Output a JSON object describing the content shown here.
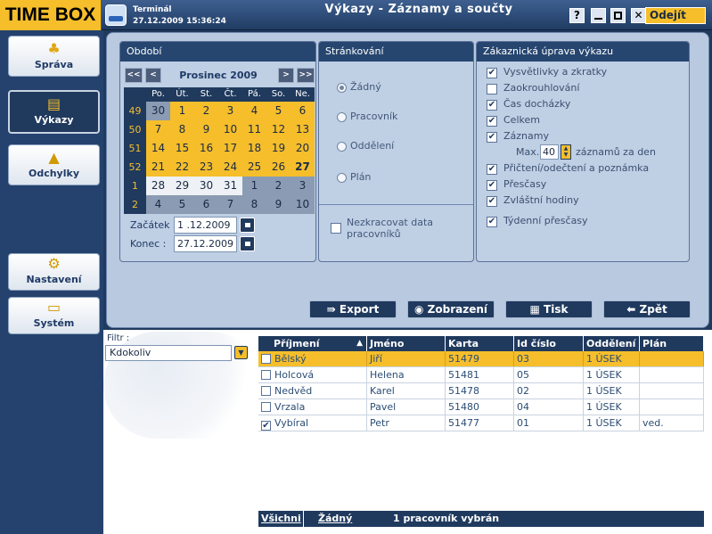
{
  "app": {
    "logo": "TIME BOX",
    "terminal_label": "Terminál",
    "datetime": "27.12.2009 15:36:24",
    "window_title": "Výkazy - Záznamy a součty",
    "help_label": "?",
    "logout_label": "Odejít"
  },
  "sidebar": {
    "items": [
      {
        "label": "Správa",
        "icon": "users-icon",
        "active": false
      },
      {
        "label": "Výkazy",
        "icon": "report-icon",
        "active": true
      },
      {
        "label": "Odchylky",
        "icon": "warning-icon",
        "active": false
      },
      {
        "label": "Nastavení",
        "icon": "gear-icon",
        "active": false
      },
      {
        "label": "Systém",
        "icon": "computer-icon",
        "active": false
      }
    ]
  },
  "obdobi": {
    "title": "Období",
    "nav": {
      "first": "<<",
      "prev": "<",
      "next": ">",
      "last": ">>"
    },
    "month": "Prosinec 2009",
    "weekdays": [
      "Po.",
      "Út.",
      "St.",
      "Čt.",
      "Pá.",
      "So.",
      "Ne."
    ],
    "weeks": [
      {
        "no": "49",
        "days": [
          "30",
          "1",
          "2",
          "3",
          "4",
          "5",
          "6"
        ]
      },
      {
        "no": "50",
        "days": [
          "7",
          "8",
          "9",
          "10",
          "11",
          "12",
          "13"
        ]
      },
      {
        "no": "51",
        "days": [
          "14",
          "15",
          "16",
          "17",
          "18",
          "19",
          "20"
        ]
      },
      {
        "no": "52",
        "days": [
          "21",
          "22",
          "23",
          "24",
          "25",
          "26",
          "27"
        ]
      },
      {
        "no": "1",
        "days": [
          "28",
          "29",
          "30",
          "31",
          "1",
          "2",
          "3"
        ]
      },
      {
        "no": "2",
        "days": [
          "4",
          "5",
          "6",
          "7",
          "8",
          "9",
          "10"
        ]
      }
    ],
    "start_label": "Začátek",
    "start_value": "1 .12.2009",
    "end_label": "Konec :",
    "end_value": "27.12.2009"
  },
  "strankovani": {
    "title": "Stránkování",
    "options": [
      "Žádný",
      "Pracovník",
      "Oddělení",
      "Plán"
    ],
    "selected": "Žádný",
    "nekracovat_label_1": "Nezkracovat data",
    "nekracovat_label_2": "pracovníků"
  },
  "uprava": {
    "title": "Zákaznická úprava výkazu",
    "items": [
      {
        "label": "Vysvětlivky a zkratky",
        "checked": true
      },
      {
        "label": "Zaokrouhlování",
        "checked": false
      },
      {
        "label": "Čas docházky",
        "checked": true
      },
      {
        "label": "Celkem",
        "checked": true
      },
      {
        "label": "Záznamy",
        "checked": true
      },
      {
        "label": "Přičtení/odečtení a poznámka",
        "checked": true
      },
      {
        "label": "Přesčasy",
        "checked": true
      },
      {
        "label": "Zvláštní hodiny",
        "checked": true
      },
      {
        "label": "Týdenní přesčasy",
        "checked": true
      }
    ],
    "max_label": "Max.",
    "max_value": "40",
    "max_suffix": "záznamů za den"
  },
  "actions": {
    "export": "Export",
    "zobrazeni": "Zobrazení",
    "tisk": "Tisk",
    "zpet": "Zpět"
  },
  "filter": {
    "label": "Filtr :",
    "value": "Kdokoliv"
  },
  "table": {
    "columns": [
      "Příjmení",
      "Jméno",
      "Karta",
      "Id číslo",
      "Oddělení",
      "Plán"
    ],
    "sort_indicator": "▲",
    "rows": [
      {
        "checked": false,
        "selected": true,
        "prijmeni": "Bělský",
        "jmeno": "Jiří",
        "karta": "51479",
        "id": "03",
        "oddeleni": "1 ÚSEK",
        "plan": ""
      },
      {
        "checked": false,
        "selected": false,
        "prijmeni": "Holcová",
        "jmeno": "Helena",
        "karta": "51481",
        "id": "05",
        "oddeleni": "1 ÚSEK",
        "plan": ""
      },
      {
        "checked": false,
        "selected": false,
        "prijmeni": "Nedvěd",
        "jmeno": "Karel",
        "karta": "51478",
        "id": "02",
        "oddeleni": "1 ÚSEK",
        "plan": ""
      },
      {
        "checked": false,
        "selected": false,
        "prijmeni": "Vrzala",
        "jmeno": "Pavel",
        "karta": "51480",
        "id": "04",
        "oddeleni": "1 ÚSEK",
        "plan": ""
      },
      {
        "checked": true,
        "selected": false,
        "prijmeni": "Vybíral",
        "jmeno": "Petr",
        "karta": "51477",
        "id": "01",
        "oddeleni": "1 ÚSEK",
        "plan": "ved."
      }
    ]
  },
  "footer": {
    "all": "Všichni",
    "none": "Žádný",
    "status": "1 pracovník vybrán"
  },
  "colors": {
    "accent": "#f5be2a",
    "navy": "#203a5e",
    "panel": "#b8c9e0"
  }
}
